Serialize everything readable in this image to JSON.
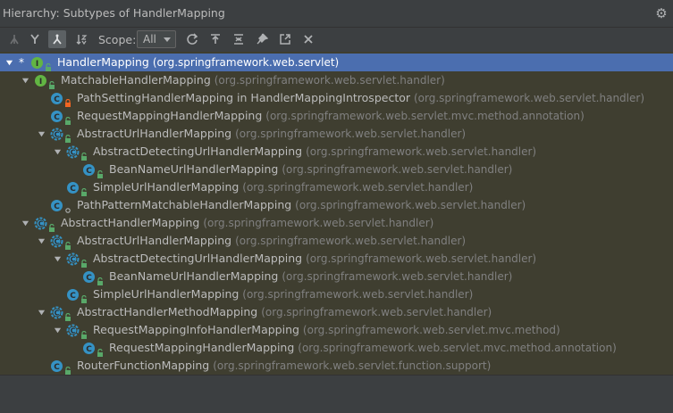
{
  "window": {
    "title": "Hierarchy:  Subtypes of HandlerMapping"
  },
  "toolbar": {
    "buttons": [
      {
        "icon": "supertypes-icon"
      },
      {
        "icon": "subtypes-icon"
      },
      {
        "icon": "class-hierarchy-icon",
        "active": true
      },
      {
        "icon": "sort-alpha-icon"
      }
    ],
    "scope_label": "Scope:",
    "scope_value": "All",
    "actions": [
      {
        "icon": "refresh-icon"
      },
      {
        "icon": "export-icon"
      },
      {
        "icon": "collapse-all-icon"
      },
      {
        "icon": "pin-icon"
      },
      {
        "icon": "open-in-window-icon"
      },
      {
        "icon": "close-icon"
      }
    ]
  },
  "tree": {
    "rows": [
      {
        "depth": 0,
        "expand": "open",
        "star": true,
        "kind": "interface",
        "vis": "public",
        "name": "HandlerMapping",
        "pkg": "(org.springframework.web.servlet)",
        "selected": true
      },
      {
        "depth": 1,
        "expand": "open",
        "kind": "interface",
        "vis": "public",
        "name": "MatchableHandlerMapping",
        "pkg": "(org.springframework.web.servlet.handler)"
      },
      {
        "depth": 2,
        "expand": "none",
        "kind": "class",
        "vis": "private",
        "name": "PathSettingHandlerMapping in HandlerMappingIntrospector",
        "pkg": "(org.springframework.web.servlet.handler)"
      },
      {
        "depth": 2,
        "expand": "none",
        "kind": "class",
        "vis": "public",
        "name": "RequestMappingHandlerMapping",
        "pkg": "(org.springframework.web.servlet.mvc.method.annotation)"
      },
      {
        "depth": 2,
        "expand": "open",
        "kind": "abstract",
        "vis": "public",
        "name": "AbstractUrlHandlerMapping",
        "pkg": "(org.springframework.web.servlet.handler)"
      },
      {
        "depth": 3,
        "expand": "open",
        "kind": "abstract",
        "vis": "public",
        "name": "AbstractDetectingUrlHandlerMapping",
        "pkg": "(org.springframework.web.servlet.handler)"
      },
      {
        "depth": 4,
        "expand": "none",
        "kind": "class",
        "vis": "public",
        "name": "BeanNameUrlHandlerMapping",
        "pkg": "(org.springframework.web.servlet.handler)"
      },
      {
        "depth": 3,
        "expand": "none",
        "kind": "class",
        "vis": "public",
        "name": "SimpleUrlHandlerMapping",
        "pkg": "(org.springframework.web.servlet.handler)"
      },
      {
        "depth": 2,
        "expand": "none",
        "kind": "class",
        "vis": "package",
        "name": "PathPatternMatchableHandlerMapping",
        "pkg": "(org.springframework.web.servlet.handler)"
      },
      {
        "depth": 1,
        "expand": "open",
        "kind": "abstract",
        "vis": "public",
        "name": "AbstractHandlerMapping",
        "pkg": "(org.springframework.web.servlet.handler)"
      },
      {
        "depth": 2,
        "expand": "open",
        "kind": "abstract",
        "vis": "public",
        "name": "AbstractUrlHandlerMapping",
        "pkg": "(org.springframework.web.servlet.handler)"
      },
      {
        "depth": 3,
        "expand": "open",
        "kind": "abstract",
        "vis": "public",
        "name": "AbstractDetectingUrlHandlerMapping",
        "pkg": "(org.springframework.web.servlet.handler)"
      },
      {
        "depth": 4,
        "expand": "none",
        "kind": "class",
        "vis": "public",
        "name": "BeanNameUrlHandlerMapping",
        "pkg": "(org.springframework.web.servlet.handler)"
      },
      {
        "depth": 3,
        "expand": "none",
        "kind": "class",
        "vis": "public",
        "name": "SimpleUrlHandlerMapping",
        "pkg": "(org.springframework.web.servlet.handler)"
      },
      {
        "depth": 2,
        "expand": "open",
        "kind": "abstract",
        "vis": "public",
        "name": "AbstractHandlerMethodMapping",
        "pkg": "(org.springframework.web.servlet.handler)"
      },
      {
        "depth": 3,
        "expand": "open",
        "kind": "abstract",
        "vis": "public",
        "name": "RequestMappingInfoHandlerMapping",
        "pkg": "(org.springframework.web.servlet.mvc.method)"
      },
      {
        "depth": 4,
        "expand": "none",
        "kind": "class",
        "vis": "public",
        "name": "RequestMappingHandlerMapping",
        "pkg": "(org.springframework.web.servlet.mvc.method.annotation)"
      },
      {
        "depth": 2,
        "expand": "none",
        "kind": "class",
        "vis": "public",
        "name": "RouterFunctionMapping",
        "pkg": "(org.springframework.web.servlet.function.support)"
      }
    ]
  },
  "colors": {
    "selection": "#4b6eaf",
    "class_icon": "#3592c4",
    "interface_icon": "#62b543",
    "public_vis": "#59a869",
    "private_vis": "#f26522"
  }
}
